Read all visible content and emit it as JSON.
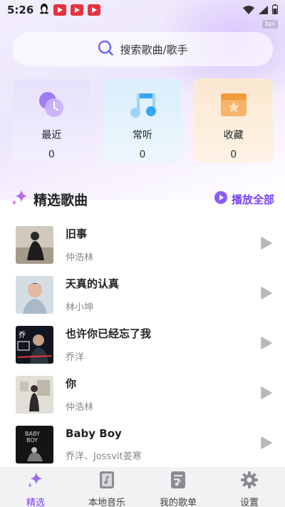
{
  "status_bar": {
    "time": "5:26",
    "watermark": "bpi"
  },
  "search": {
    "placeholder": "搜索歌曲/歌手"
  },
  "shortcuts": [
    {
      "label": "最近",
      "count": "0",
      "icon": "clock-icon"
    },
    {
      "label": "常听",
      "count": "0",
      "icon": "music-note-icon"
    },
    {
      "label": "收藏",
      "count": "0",
      "icon": "star-box-icon"
    }
  ],
  "featured": {
    "title": "精选歌曲",
    "play_all_label": "播放全部",
    "songs": [
      {
        "title": "旧事",
        "artist": "仲浩林"
      },
      {
        "title": "天真的认真",
        "artist": "林小坤"
      },
      {
        "title": "也许你已经忘了我",
        "artist": "乔洋"
      },
      {
        "title": "你",
        "artist": "仲浩林"
      },
      {
        "title": "Baby Boy",
        "artist": "乔洋、Jossvit姜寒"
      }
    ]
  },
  "tabs": [
    {
      "label": "精选",
      "active": true
    },
    {
      "label": "本地音乐",
      "active": false
    },
    {
      "label": "我的歌单",
      "active": false
    },
    {
      "label": "设置",
      "active": false
    }
  ],
  "colors": {
    "accent": "#7b3ff2",
    "tab_bg": "#f2f2f4"
  }
}
